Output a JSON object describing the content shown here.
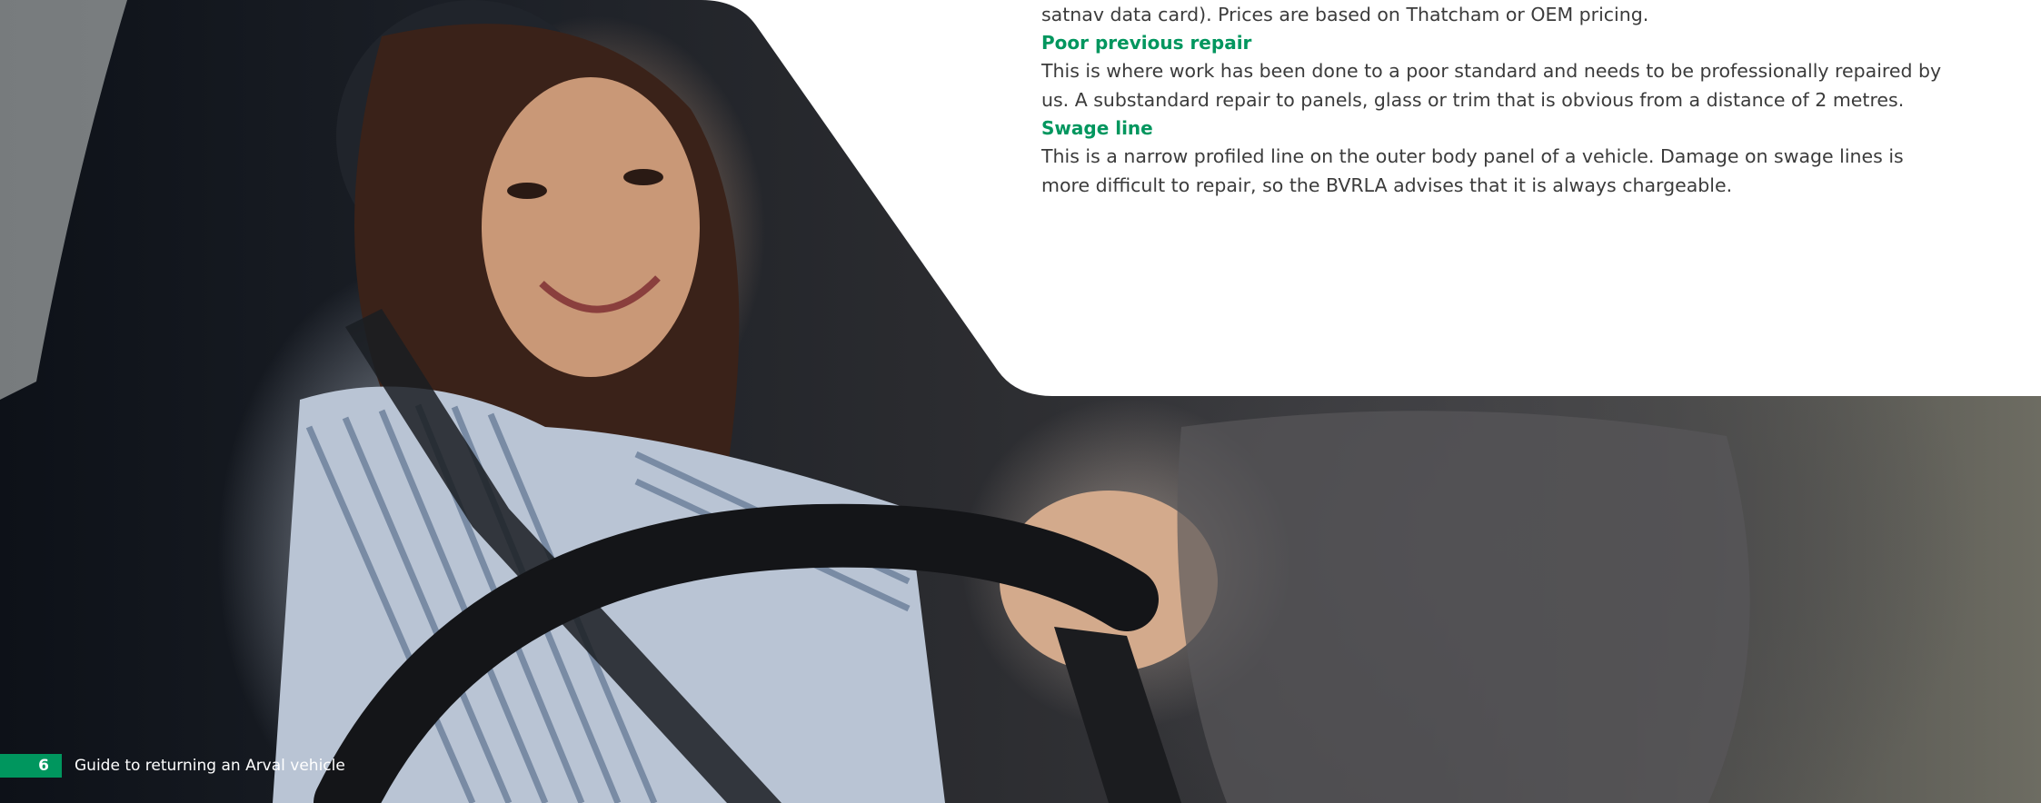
{
  "content": {
    "cut_line": "satnav data card). Prices are based on Thatcham or OEM pricing.",
    "sections": [
      {
        "term": "Poor previous repair",
        "lines": [
          "This is where work has been done to a poor standard and needs to be professionally repaired by",
          "us. A substandard repair to panels, glass or trim that is obvious from a distance of 2 metres."
        ]
      },
      {
        "term": "Swage line",
        "lines": [
          "This is a narrow profiled line on the outer body panel of a vehicle. Damage on swage lines is",
          "more difficult to repair, so the BVRLA advises that it is always chargeable."
        ]
      }
    ]
  },
  "footer": {
    "page_number": "6",
    "document_title": "Guide to returning an Arval vehicle"
  },
  "colors": {
    "accent_green": "#00965e",
    "panel_white": "#ffffff",
    "body_text": "#3b3b3b"
  }
}
